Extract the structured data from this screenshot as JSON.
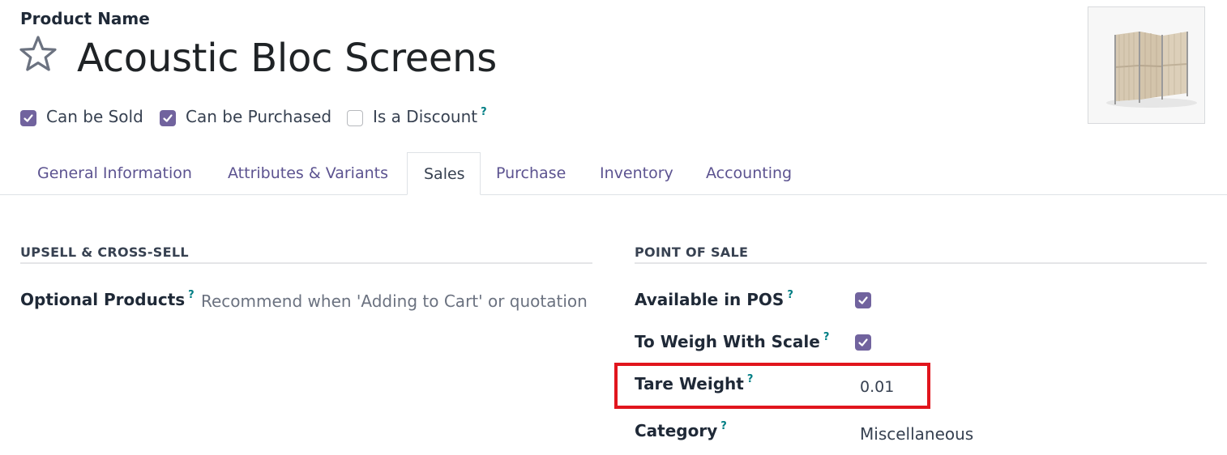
{
  "header": {
    "field_label": "Product Name",
    "product_name": "Acoustic Bloc Screens",
    "favorite_icon": "star-outline-icon"
  },
  "options": [
    {
      "label": "Can be Sold",
      "checked": true,
      "help": ""
    },
    {
      "label": "Can be Purchased",
      "checked": true,
      "help": ""
    },
    {
      "label": "Is a Discount",
      "checked": false,
      "help": "?"
    }
  ],
  "tabs": [
    {
      "label": "General Information",
      "active": false
    },
    {
      "label": "Attributes & Variants",
      "active": false
    },
    {
      "label": "Sales",
      "active": true
    },
    {
      "label": "Purchase",
      "active": false
    },
    {
      "label": "Inventory",
      "active": false
    },
    {
      "label": "Accounting",
      "active": false
    }
  ],
  "upsell": {
    "heading": "UPSELL & CROSS-SELL",
    "optional_products_label": "Optional Products",
    "optional_products_help": "?",
    "optional_products_placeholder": "Recommend when 'Adding to Cart' or quotation"
  },
  "pos": {
    "heading": "POINT OF SALE",
    "available_label": "Available in POS",
    "available_help": "?",
    "available_checked": true,
    "scale_label": "To Weigh With Scale",
    "scale_help": "?",
    "scale_checked": true,
    "tare_label": "Tare Weight",
    "tare_help": "?",
    "tare_value": "0.01",
    "category_label": "Category",
    "category_help": "?",
    "category_value": "Miscellaneous"
  },
  "colors": {
    "accent": "#71639e",
    "tab_link": "#5c5390",
    "help": "#017e84",
    "highlight": "#e1151d"
  }
}
